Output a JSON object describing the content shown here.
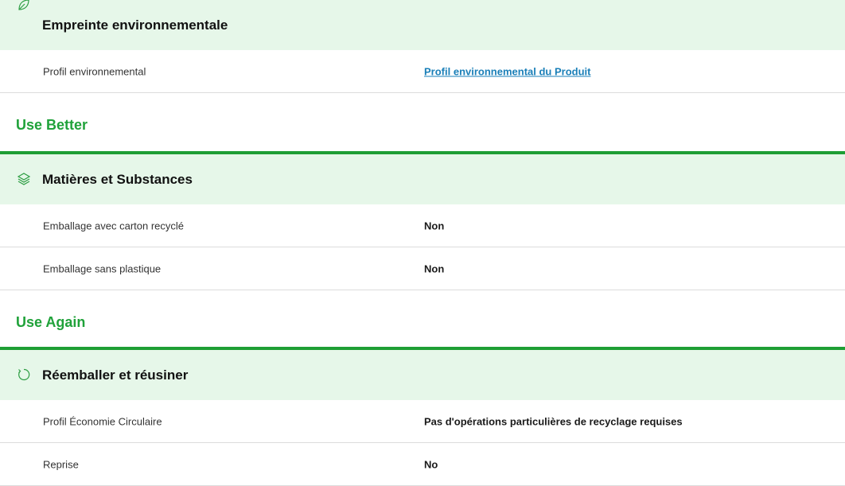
{
  "colors": {
    "accent_green": "#1e9e34",
    "header_bg": "#e6f7e9",
    "link_blue": "#1a7fb8"
  },
  "blocks": [
    {
      "header": {
        "title": "Empreinte environnementale",
        "icon": "leaf-icon"
      },
      "rows": [
        {
          "label": "Profil environnemental",
          "value": "Profil environnemental du Produit",
          "is_link": true
        }
      ]
    },
    {
      "section_title": "Use Better",
      "header": {
        "title": "Matières et Substances",
        "icon": "layers-icon"
      },
      "rows": [
        {
          "label": "Emballage avec carton recyclé",
          "value": "Non"
        },
        {
          "label": "Emballage sans plastique",
          "value": "Non"
        }
      ]
    },
    {
      "section_title": "Use Again",
      "header": {
        "title": "Réemballer et réusiner",
        "icon": "refresh-icon"
      },
      "rows": [
        {
          "label": "Profil Économie Circulaire",
          "value": "Pas d'opérations particulières de recyclage requises"
        },
        {
          "label": "Reprise",
          "value": "No"
        }
      ]
    }
  ]
}
